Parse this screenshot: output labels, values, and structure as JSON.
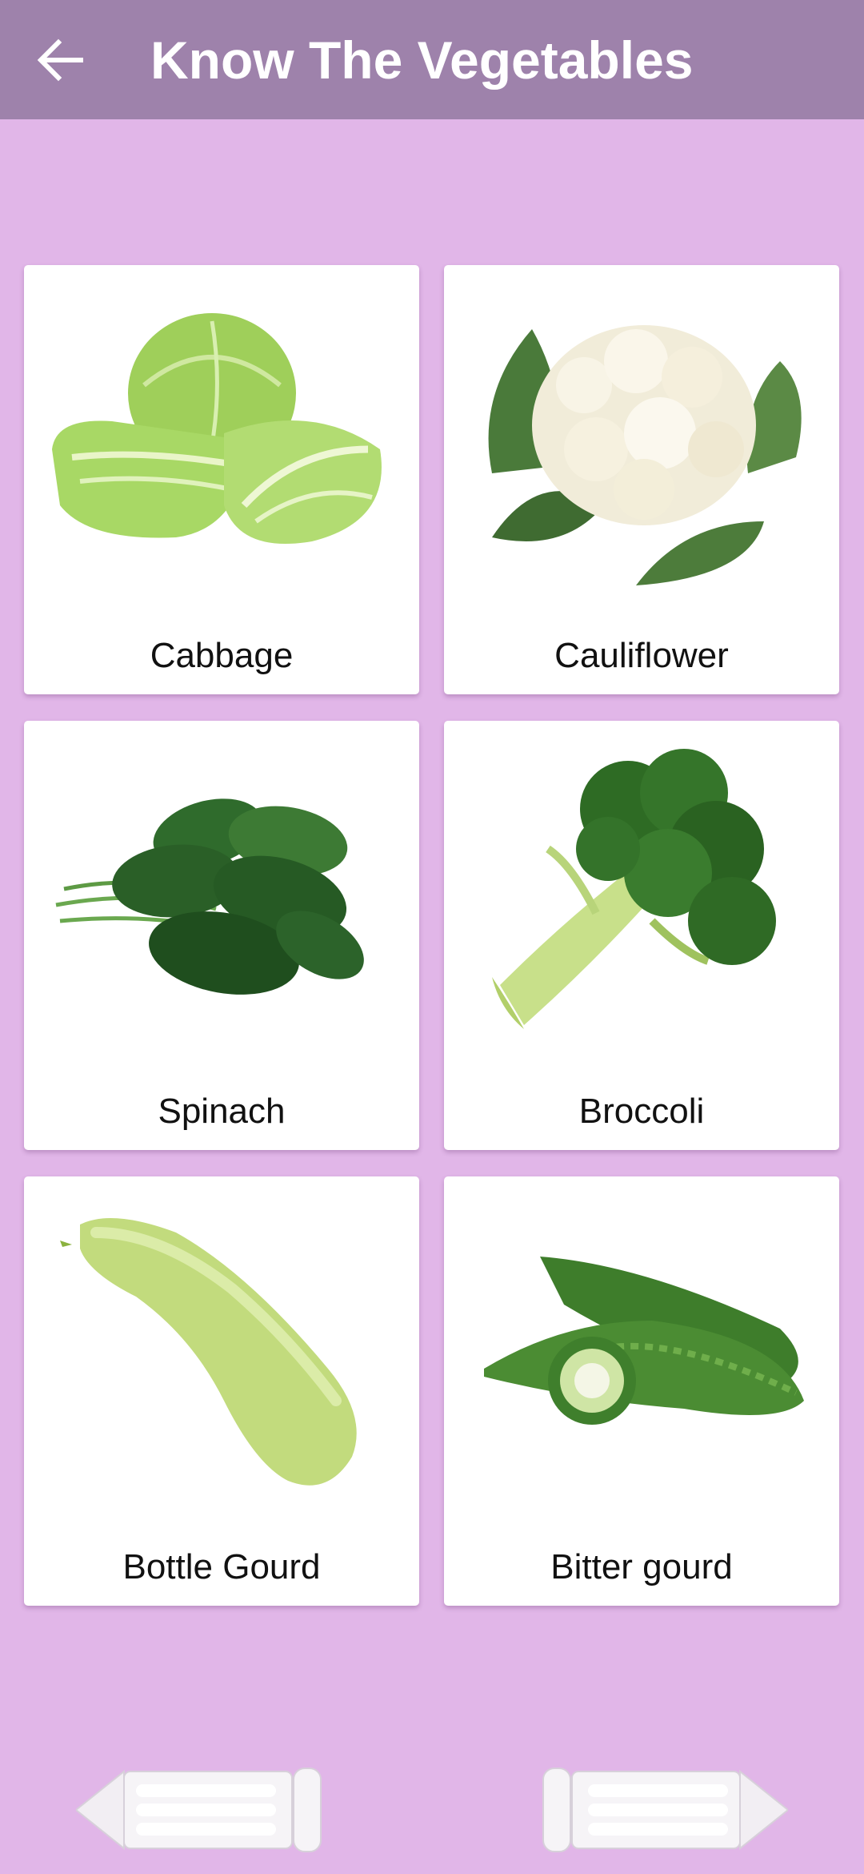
{
  "header": {
    "title": "Know The Vegetables",
    "back_icon": "arrow-left-icon"
  },
  "vegetables": [
    {
      "name": "Cabbage"
    },
    {
      "name": "Cauliflower"
    },
    {
      "name": "Spinach"
    },
    {
      "name": "Broccoli"
    },
    {
      "name": "Bottle Gourd"
    },
    {
      "name": "Bitter gourd"
    }
  ],
  "navigation": {
    "prev_icon": "pencil-arrow-left-icon",
    "next_icon": "pencil-arrow-right-icon"
  },
  "colors": {
    "appbar": "#9e82ab",
    "background": "#e1b6e8",
    "card": "#ffffff"
  }
}
